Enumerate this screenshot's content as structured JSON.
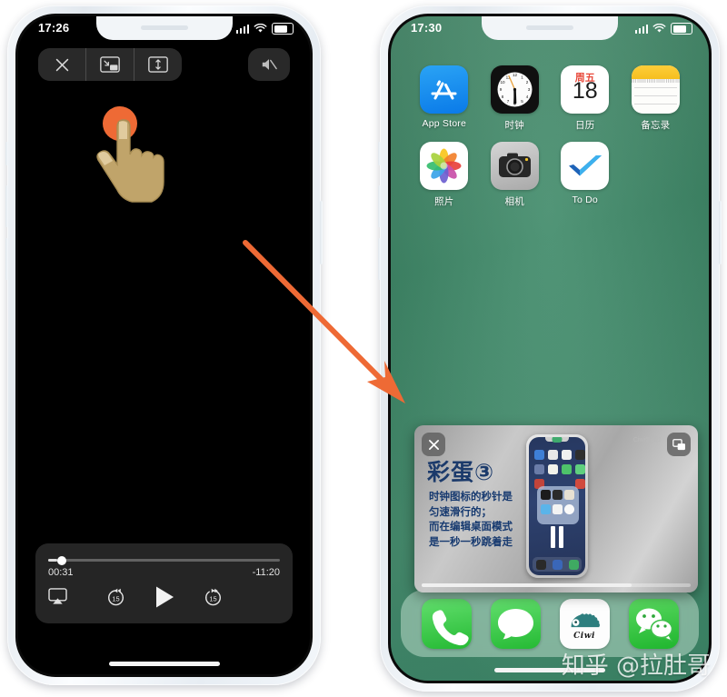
{
  "left_phone": {
    "status": {
      "time": "17:26",
      "signal_icon": "cellular-signal-icon",
      "wifi_icon": "wifi-icon",
      "battery_icon": "battery-icon"
    },
    "overlay_controls": [
      {
        "name": "close-button",
        "icon": "close-x-icon"
      },
      {
        "name": "picture-in-picture-button",
        "icon": "picture-in-picture-icon"
      },
      {
        "name": "expand-button",
        "icon": "expand-vertical-icon"
      }
    ],
    "mute_button": {
      "name": "mute-button",
      "icon": "speaker-muted-icon"
    },
    "touch_indicator": {
      "name": "touch-point",
      "color": "#ee6a35",
      "cursor_icon": "pointing-hand-icon"
    },
    "player": {
      "elapsed": "00:31",
      "remaining": "-11:20",
      "progress_percent": 4,
      "airplay_icon": "airplay-icon",
      "back_label": "15",
      "forward_label": "15",
      "play_icon": "play-icon",
      "back_icon": "skip-back-15-icon",
      "forward_icon": "skip-forward-15-icon"
    }
  },
  "right_phone": {
    "status": {
      "time": "17:30",
      "signal_icon": "cellular-signal-icon",
      "wifi_icon": "wifi-icon",
      "battery_icon": "battery-icon"
    },
    "wallpaper_color": "#4a9173",
    "home_rows": [
      [
        {
          "label": "App Store",
          "icon": "app-store-icon"
        },
        {
          "label": "时钟",
          "icon": "clock-icon"
        },
        {
          "label": "日历",
          "icon": "calendar-icon",
          "weekday": "周五",
          "day": "18"
        },
        {
          "label": "备忘录",
          "icon": "notes-icon"
        }
      ],
      [
        {
          "label": "照片",
          "icon": "photos-icon"
        },
        {
          "label": "相机",
          "icon": "camera-icon"
        },
        {
          "label": "To Do",
          "icon": "todo-checkmark-icon"
        }
      ]
    ],
    "dock": [
      {
        "label": "电话",
        "icon": "phone-icon"
      },
      {
        "label": "信息",
        "icon": "messages-icon"
      },
      {
        "label": "Ciwi",
        "icon": "ciwi-hedgehog-icon",
        "text": "Ciwi"
      },
      {
        "label": "微信",
        "icon": "wechat-icon"
      }
    ],
    "pip": {
      "title": "彩蛋③",
      "body": "时钟图标的秒针是\n匀速滑行的；\n而在编辑桌面模式\n是一秒一秒跳着走",
      "watermark": "Ciwi刺猬1",
      "close_icon": "close-x-icon",
      "expand_icon": "picture-in-picture-restore-icon",
      "scroll_percent": 78
    }
  },
  "annotation": {
    "arrow_icon": "orange-arrow-icon",
    "arrow_color": "#ee6a35"
  },
  "watermark": "知乎 @拉肚哥"
}
